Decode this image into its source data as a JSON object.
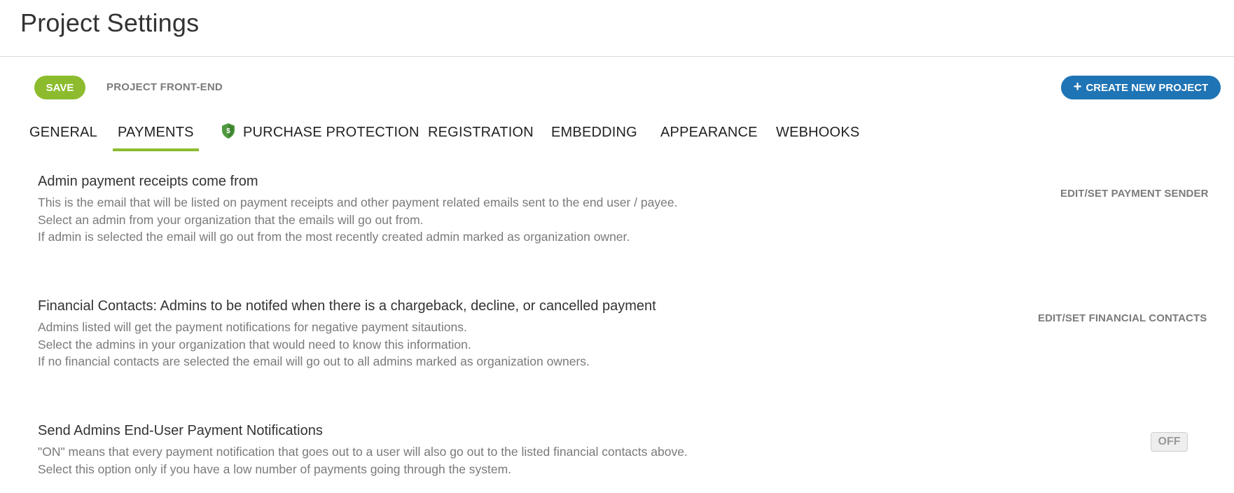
{
  "header": {
    "title": "Project Settings"
  },
  "toolbar": {
    "save_label": "SAVE",
    "frontend_label": "PROJECT FRONT-END",
    "create_label": "CREATE NEW PROJECT"
  },
  "tabs": [
    {
      "label": "GENERAL"
    },
    {
      "label": "PAYMENTS",
      "active": true
    },
    {
      "label": "PURCHASE PROTECTION",
      "icon": "shield-dollar-icon"
    },
    {
      "label": "REGISTRATION"
    },
    {
      "label": "EMBEDDING"
    },
    {
      "label": "APPEARANCE"
    },
    {
      "label": "WEBHOOKS"
    }
  ],
  "sections": [
    {
      "title": "Admin payment receipts come from",
      "lines": [
        "This is the email that will be listed on payment receipts and other payment related emails sent to the end user / payee.",
        "Select an admin from your organization that the emails will go out from.",
        "If admin is selected the email will go out from the most recently created admin marked as organization owner."
      ],
      "action": "EDIT/SET PAYMENT SENDER"
    },
    {
      "title": "Financial Contacts: Admins to be notifed when there is a chargeback, decline, or cancelled payment",
      "lines": [
        "Admins listed will get the payment notifications for negative payment sitautions.",
        "Select the admins in your organization that would need to know this information.",
        "If no financial contacts are selected the email will go out to all admins marked as organization owners."
      ],
      "action": "EDIT/SET FINANCIAL CONTACTS"
    },
    {
      "title": "Send Admins End-User Payment Notifications",
      "lines": [
        "\"ON\" means that every payment notification that goes out to a user will also go out to the listed financial contacts above.",
        "Select this option only if you have a low number of payments going through the system."
      ],
      "toggle": "OFF"
    }
  ],
  "colors": {
    "save_green": "#8cbc2e",
    "create_blue": "#1f74b5",
    "active_tab_underline": "#8cbc2e",
    "shield_green": "#4f9a3e"
  }
}
